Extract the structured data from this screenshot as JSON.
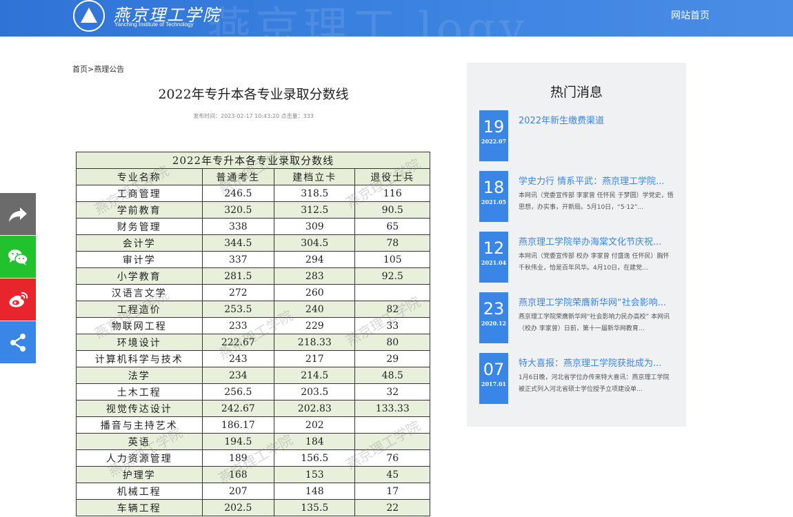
{
  "header": {
    "logo_cn": "燕京理工学院",
    "logo_en": "Yanching Institute of Technology",
    "watermark": "燕京理工 logy",
    "nav_home": "网站首页"
  },
  "breadcrumb": {
    "home": "首页",
    "separator": ">",
    "section": "燕理公告"
  },
  "article": {
    "title": "2022年专升本各专业录取分数线",
    "meta": "发布时间：2023-02-17 10:43:20 点击量：333"
  },
  "score_table": {
    "caption": "2022年专升本各专业录取分数线",
    "headers": [
      "专业名称",
      "普通考生",
      "建档立卡",
      "退役士兵"
    ],
    "rows": [
      [
        "工商管理",
        "246.5",
        "318.5",
        "116"
      ],
      [
        "学前教育",
        "320.5",
        "312.5",
        "90.5"
      ],
      [
        "财务管理",
        "338",
        "309",
        "65"
      ],
      [
        "会计学",
        "344.5",
        "304.5",
        "78"
      ],
      [
        "审计学",
        "337",
        "294",
        "105"
      ],
      [
        "小学教育",
        "281.5",
        "283",
        "92.5"
      ],
      [
        "汉语言文学",
        "272",
        "260",
        ""
      ],
      [
        "工程造价",
        "253.5",
        "240",
        "82"
      ],
      [
        "物联网工程",
        "233",
        "229",
        "33"
      ],
      [
        "环境设计",
        "222.67",
        "218.33",
        "80"
      ],
      [
        "计算机科学与技术",
        "243",
        "217",
        "29"
      ],
      [
        "法学",
        "234",
        "214.5",
        "48.5"
      ],
      [
        "土木工程",
        "256.5",
        "203.5",
        "32"
      ],
      [
        "视觉传达设计",
        "242.67",
        "202.83",
        "133.33"
      ],
      [
        "播音与主持艺术",
        "186.17",
        "202",
        ""
      ],
      [
        "英语",
        "194.5",
        "184",
        ""
      ],
      [
        "人力资源管理",
        "189",
        "156.5",
        "76"
      ],
      [
        "护理学",
        "168",
        "153",
        "45"
      ],
      [
        "机械工程",
        "207",
        "148",
        "17"
      ],
      [
        "车辆工程",
        "202.5",
        "135.5",
        "22"
      ]
    ],
    "watermark": "燕京理工学院"
  },
  "sidebar": {
    "title": "热门消息",
    "items": [
      {
        "day": "19",
        "ym": "2022.07",
        "title": "2022年新生缴费渠道",
        "summary": ""
      },
      {
        "day": "18",
        "ym": "2021.05",
        "title": "学史力行 情系平武：燕京理工学院...",
        "summary": "本网讯（党委宣传部 李家曾 任怀民 于梦圆）学党史，悟思想，办实事，开新局。5月10日，“5·12”..."
      },
      {
        "day": "12",
        "ym": "2021.04",
        "title": "燕京理工学院举办海棠文化节庆祝...",
        "summary": "本网讯（党委宣传部 校办 李家曾 付盛逸 任怀民）胸怀千秋伟业，恰是百年风华。4月10日，在建党..."
      },
      {
        "day": "23",
        "ym": "2020.12",
        "title": "燕京理工学院荣膺新华网“社会影响...",
        "summary": "燕京理工学院荣膺新华网“社会影响力民办高校” 本网讯（校办 李家曾）日前，第十一届新华网教育..."
      },
      {
        "day": "07",
        "ym": "2017.01",
        "title": "特大喜报：燕京理工学院获批成为...",
        "summary": "1月6日晚，河北省学位办传来特大喜讯：燕京理工学院被正式列入河北省硕士学位授予立项建设单..."
      }
    ]
  },
  "share": {
    "icons": [
      "forward-icon",
      "wechat-icon",
      "weibo-icon",
      "share-icon"
    ]
  }
}
